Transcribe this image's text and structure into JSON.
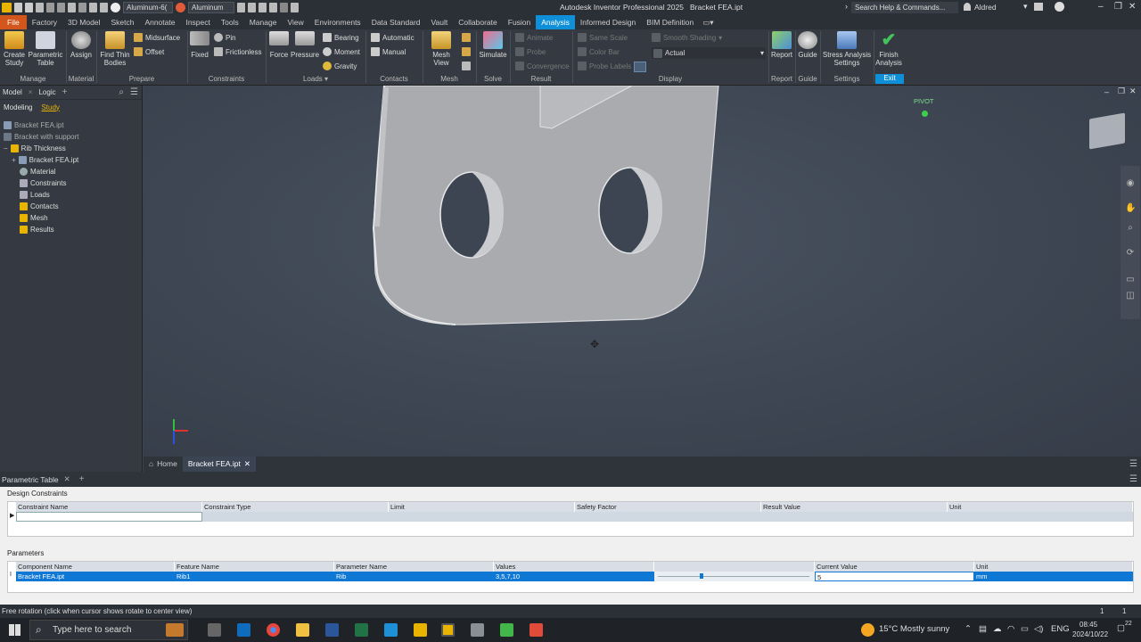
{
  "titlebar": {
    "material_combo": "Aluminum-6(",
    "appearance_combo": "Aluminum",
    "app_title": "Autodesk Inventor Professional 2025",
    "doc_title": "Bracket FEA.ipt",
    "search_placeholder": "Search Help & Commands...",
    "user": "Aldred"
  },
  "tabs": [
    "File",
    "Factory",
    "3D Model",
    "Sketch",
    "Annotate",
    "Inspect",
    "Tools",
    "Manage",
    "View",
    "Environments",
    "Data Standard",
    "Vault",
    "Collaborate",
    "Fusion",
    "Analysis",
    "Informed Design",
    "BIM Definition"
  ],
  "ribbon": {
    "manage": {
      "create_study": "Create\nStudy",
      "parametric_table": "Parametric\nTable",
      "label": "Manage"
    },
    "material": {
      "assign": "Assign",
      "label": "Material"
    },
    "prepare": {
      "find_thin_bodies": "Find Thin\nBodies",
      "midsurface": "Midsurface",
      "offset": "Offset",
      "label": "Prepare"
    },
    "constraints": {
      "fixed": "Fixed",
      "pin": "Pin",
      "frictionless": "Frictionless",
      "label": "Constraints"
    },
    "loads": {
      "force": "Force",
      "pressure": "Pressure",
      "bearing": "Bearing",
      "moment": "Moment",
      "gravity": "Gravity",
      "label": "Loads"
    },
    "contacts": {
      "automatic": "Automatic",
      "manual": "Manual",
      "label": "Contacts"
    },
    "mesh": {
      "mesh_view": "Mesh View",
      "label": "Mesh"
    },
    "solve": {
      "simulate": "Simulate",
      "label": "Solve"
    },
    "result": {
      "animate": "Animate",
      "probe": "Probe",
      "convergence": "Convergence",
      "label": "Result"
    },
    "display": {
      "same_scale": "Same Scale",
      "color_bar": "Color Bar",
      "probe_labels": "Probe Labels",
      "smooth_shading": "Smooth Shading",
      "actual": "Actual",
      "label": "Display"
    },
    "report": {
      "report": "Report",
      "label": "Report"
    },
    "guide": {
      "guide": "Guide",
      "label": "Guide"
    },
    "settings": {
      "stress_settings": "Stress Analysis\nSettings",
      "label": "Settings"
    },
    "exit": {
      "finish": "Finish\nAnalysis",
      "label": "Exit"
    }
  },
  "browser": {
    "tabs": [
      "Model",
      "Logic"
    ],
    "subtabs": [
      "Modeling",
      "Study"
    ],
    "items": [
      "Bracket FEA.ipt",
      "Bracket with support",
      "Rib Thickness",
      "Bracket FEA.ipt",
      "Material",
      "Constraints",
      "Loads",
      "Contacts",
      "Mesh",
      "Results"
    ]
  },
  "viewport": {
    "pivot_label": "PIVOT",
    "doc_tabs": [
      "Home",
      "Bracket FEA.ipt"
    ]
  },
  "parametric": {
    "panel_title": "Parametric Table",
    "design_constraints_label": "Design Constraints",
    "dc_columns": [
      "Constraint Name",
      "Constraint Type",
      "Limit",
      "Safety Factor",
      "Result Value",
      "Unit"
    ],
    "parameters_label": "Parameters",
    "p_columns": [
      "Component Name",
      "Feature Name",
      "Parameter Name",
      "Values",
      "",
      "Current Value",
      "Unit"
    ],
    "p_row": [
      "Bracket FEA.ipt",
      "Rib1",
      "Rib",
      "3,5,7,10",
      "",
      "5",
      "mm"
    ]
  },
  "status": {
    "message": "Free rotation (click when cursor shows rotate to center view)",
    "count1": "1",
    "count2": "1"
  },
  "taskbar": {
    "search_placeholder": "Type here to search",
    "weather": "15°C  Mostly sunny",
    "lang": "ENG",
    "time": "08:45",
    "date": "2024/10/22",
    "notif": "22"
  }
}
